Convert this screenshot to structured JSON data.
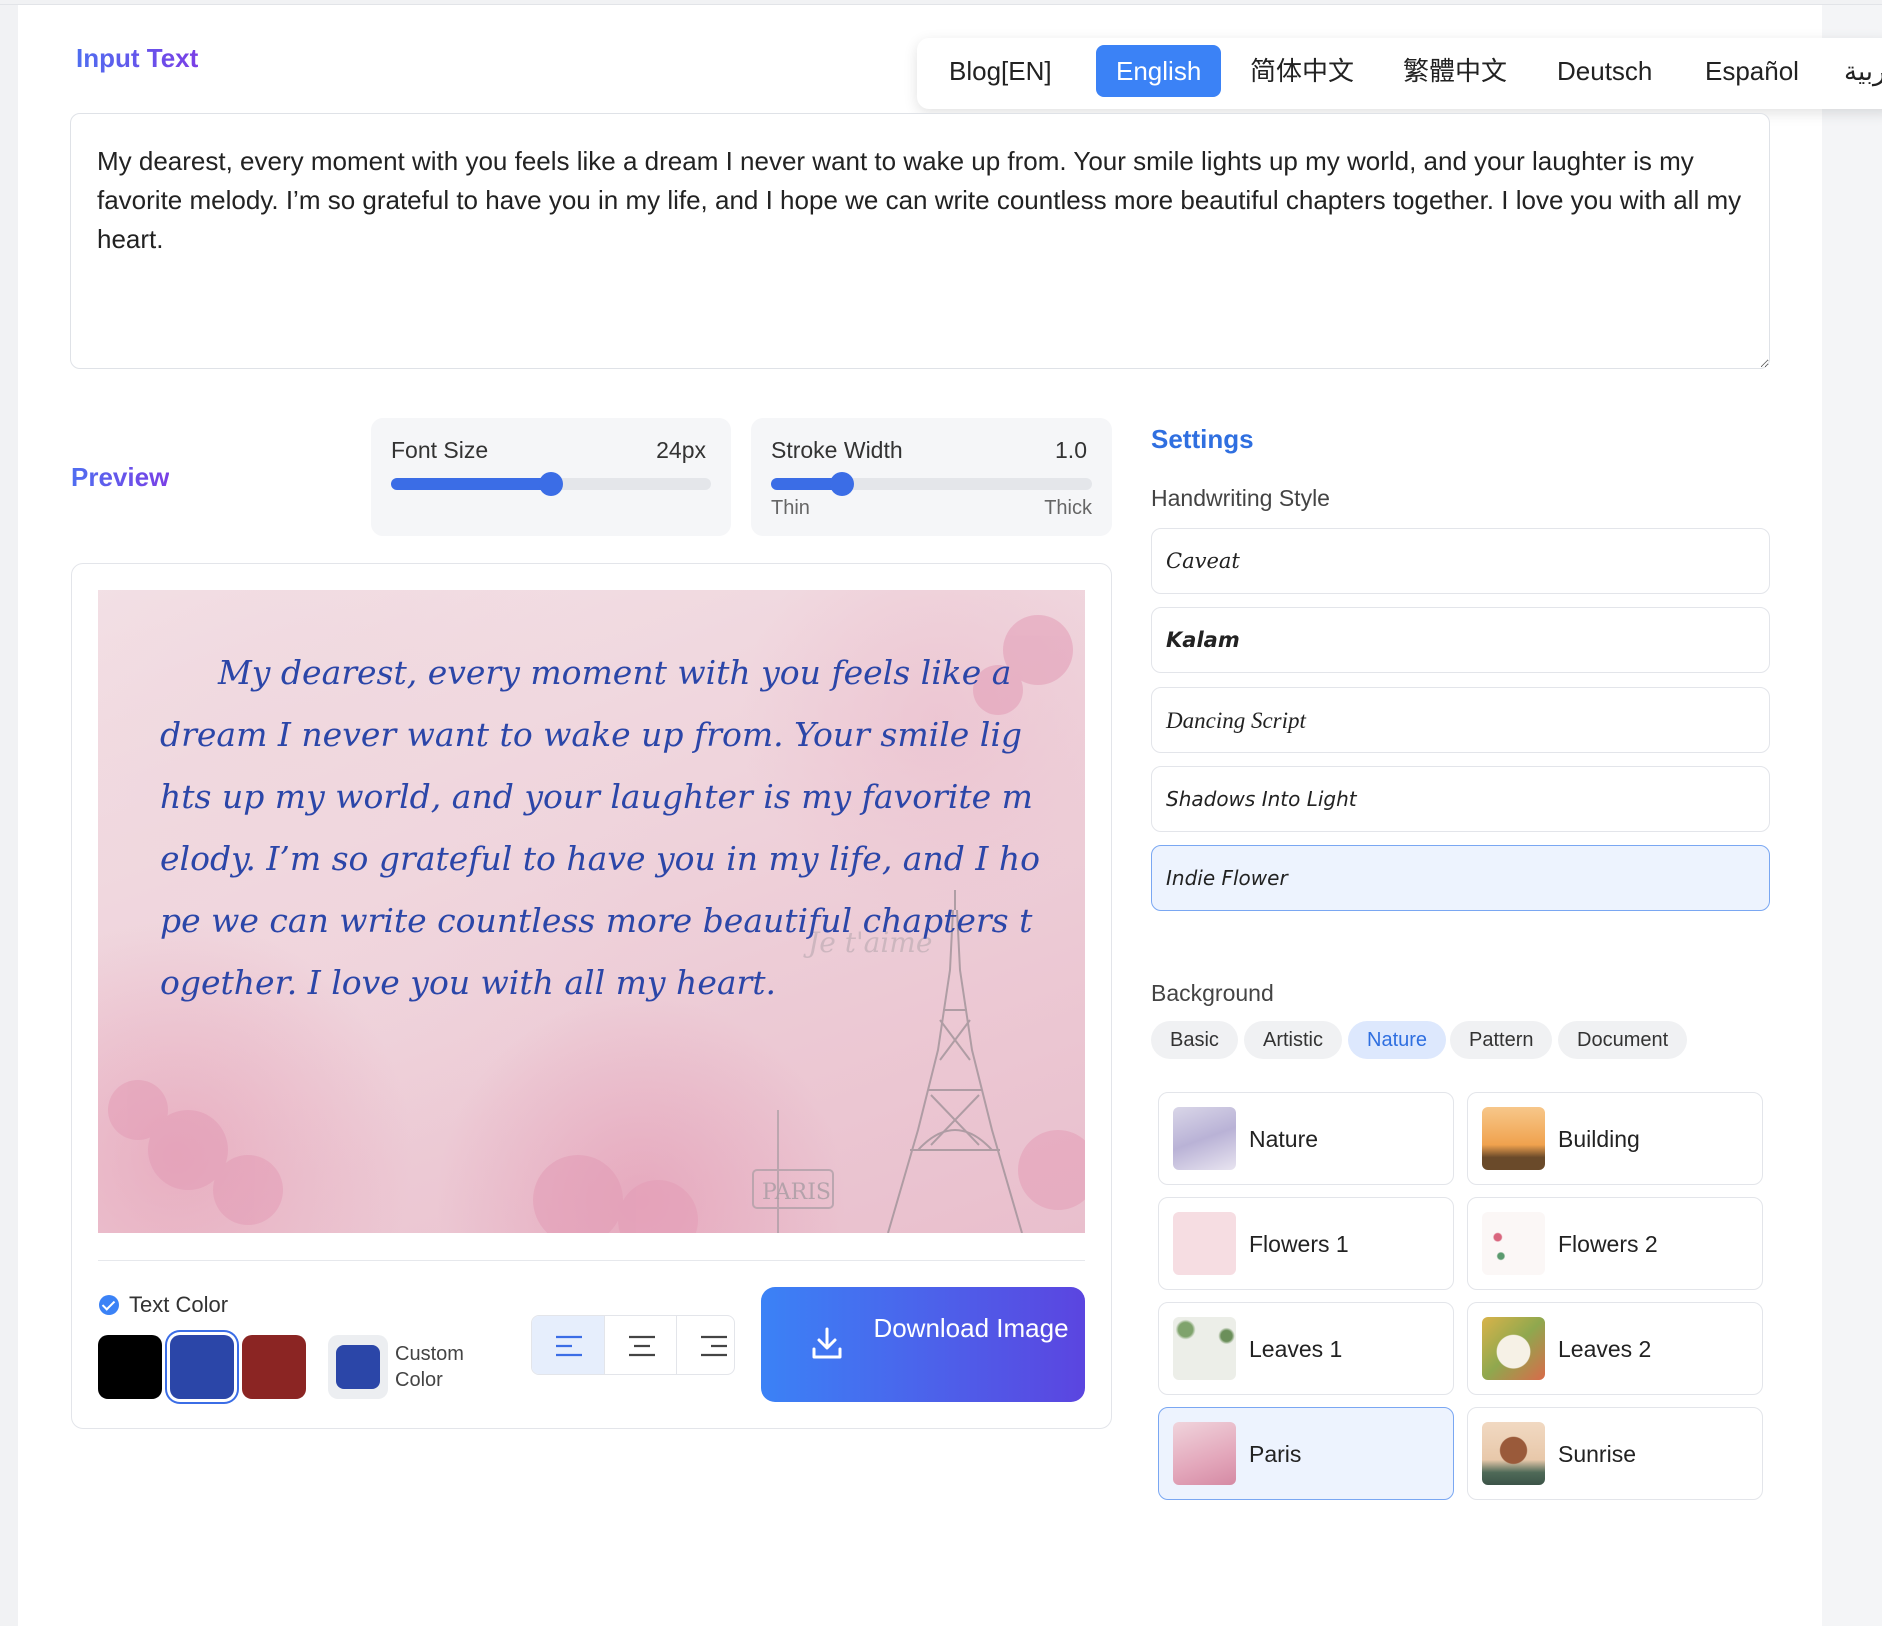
{
  "input_section": {
    "title": "Input Text",
    "text": "My dearest, every moment with you feels like a dream I never want to wake up from. Your smile lights up my world, and your laughter is my favorite melody. I’m so grateful to have you in my life, and I hope we can write countless more beautiful chapters together. I love you with all my heart."
  },
  "languages": [
    {
      "label": "Blog[EN]",
      "active": false
    },
    {
      "label": "English",
      "active": true
    },
    {
      "label": "简体中文",
      "active": false
    },
    {
      "label": "繁體中文",
      "active": false
    },
    {
      "label": "Deutsch",
      "active": false
    },
    {
      "label": "Español",
      "active": false
    },
    {
      "label": "العربية",
      "active": false
    }
  ],
  "preview": {
    "title": "Preview",
    "canvas_text": "My dearest, every moment with you feels like a dream I never want to wake up from. Your smile lights up my world, and your laughter is my favorite melody. I’m so grateful to have you in my life, and I hope we can write countless more beautiful chapters together. I love you with all my heart.",
    "watermark_text": "Je t'aime",
    "sign_text": "PARIS"
  },
  "font_size": {
    "label": "Font Size",
    "value": "24px",
    "level": 0.5
  },
  "stroke_width": {
    "label": "Stroke Width",
    "value": "1.0",
    "level": 0.22,
    "min_label": "Thin",
    "max_label": "Thick"
  },
  "text_color": {
    "label": "Text Color",
    "swatches": [
      {
        "color": "#000000",
        "selected": false
      },
      {
        "color": "#2b46a8",
        "selected": true
      },
      {
        "color": "#8b2523",
        "selected": false
      }
    ],
    "custom_label": "Custom Color",
    "custom_color": "#2b46a8"
  },
  "alignment": {
    "options": [
      "align-left",
      "align-center",
      "align-right"
    ],
    "selected": "align-left"
  },
  "download": {
    "label": "Download Image"
  },
  "settings": {
    "title": "Settings",
    "handwriting_label": "Handwriting Style",
    "fonts": [
      {
        "label": "Caveat",
        "selected": false
      },
      {
        "label": "Kalam",
        "selected": false
      },
      {
        "label": "Dancing Script",
        "selected": false
      },
      {
        "label": "Shadows Into Light",
        "selected": false
      },
      {
        "label": "Indie Flower",
        "selected": true
      }
    ],
    "background_label": "Background",
    "bg_tabs": [
      {
        "label": "Basic",
        "active": false
      },
      {
        "label": "Artistic",
        "active": false
      },
      {
        "label": "Nature",
        "active": true
      },
      {
        "label": "Pattern",
        "active": false
      },
      {
        "label": "Document",
        "active": false
      }
    ],
    "backgrounds": [
      {
        "label": "Nature",
        "selected": false
      },
      {
        "label": "Building",
        "selected": false
      },
      {
        "label": "Flowers 1",
        "selected": false
      },
      {
        "label": "Flowers 2",
        "selected": false
      },
      {
        "label": "Leaves 1",
        "selected": false
      },
      {
        "label": "Leaves 2",
        "selected": false
      },
      {
        "label": "Paris",
        "selected": true
      },
      {
        "label": "Sunrise",
        "selected": false
      }
    ]
  },
  "colors": {
    "accent": "#3b82f6",
    "text_ink": "#2b46a8"
  }
}
